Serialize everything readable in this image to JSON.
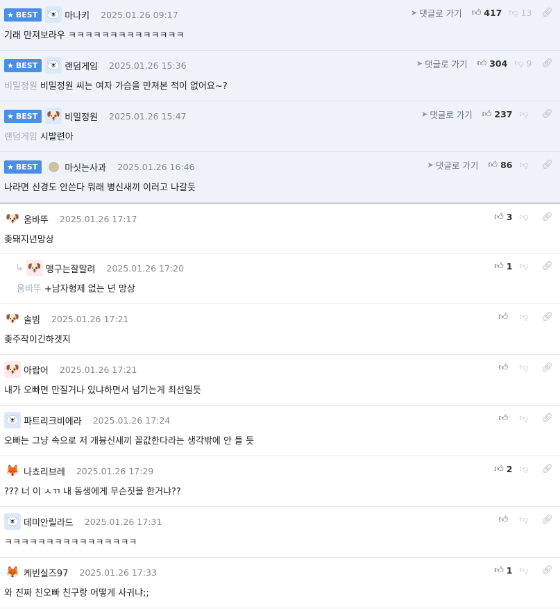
{
  "labels": {
    "best": "BEST",
    "goto": "댓글로 가기"
  },
  "icons": {
    "best": "star-icon",
    "goto": "send-arrow-icon",
    "up": "thumbs-up-icon",
    "down": "thumbs-down-icon",
    "link": "link-icon"
  },
  "colors": {
    "best_bg": "#eef3fa",
    "badge": "#4a8fe7",
    "muted": "#a7adb5"
  },
  "comments": [
    {
      "nick": "마나키",
      "date": "2025.01.26 09:17",
      "text": "기래 만져보라우 ㅋㅋㅋㅋㅋㅋㅋㅋㅋㅋㅋㅋㅋㅋ",
      "mention": "",
      "likes": "417",
      "dislikes": "13"
    },
    {
      "nick": "랜덤게임",
      "date": "2025.01.26 15:36",
      "text": "비밀정원 씨는 여자 가슴을 만져본 적이 없어요~?",
      "mention": "비밀정원",
      "likes": "304",
      "dislikes": "9"
    },
    {
      "nick": "비밀정원",
      "date": "2025.01.26 15:47",
      "text": "시발련아",
      "mention": "랜덤게임",
      "likes": "237",
      "dislikes": ""
    },
    {
      "nick": "마싯는사과",
      "date": "2025.01.26 16:46",
      "text": "나라면 신경도 안쓴다 뭐래 병신새끼 이러고 나갈듯",
      "mention": "",
      "likes": "86",
      "dislikes": ""
    },
    {
      "nick": "움바뚜",
      "date": "2025.01.26 17:17",
      "text": "좆돼지년망상",
      "mention": "",
      "likes": "3",
      "dislikes": ""
    },
    {
      "nick": "맹구는잘말려",
      "date": "2025.01.26 17:20",
      "text": "+남자형제 없는 년 망상",
      "mention": "움바뚜",
      "likes": "1",
      "dislikes": ""
    },
    {
      "nick": "솔빔",
      "date": "2025.01.26 17:21",
      "text": "좆주작이긴하겟지",
      "mention": "",
      "likes": "",
      "dislikes": ""
    },
    {
      "nick": "아랍어",
      "date": "2025.01.26 17:21",
      "text": "내가 오빠면 만질거나 있냐하면서 넘기는게 최선일듯",
      "mention": "",
      "likes": "",
      "dislikes": ""
    },
    {
      "nick": "파트리크비에라",
      "date": "2025.01.26 17:24",
      "text": "오빠는 그냥 속으로 저 개븅신새끼 꼴값한다라는 생각밖에 안 들 듯",
      "mention": "",
      "likes": "",
      "dislikes": ""
    },
    {
      "nick": "나쵸리브레",
      "date": "2025.01.26 17:29",
      "text": "??? 너 이 ㅅㄲ 내 동생에게 무슨짓을 한거냐??",
      "mention": "",
      "likes": "2",
      "dislikes": ""
    },
    {
      "nick": "데미안릴라드",
      "date": "2025.01.26 17:31",
      "text": "ㅋㅋㅋㅋㅋㅋㅋㅋㅋㅋㅋㅋㅋㅋㅋㅋ",
      "mention": "",
      "likes": "",
      "dislikes": ""
    },
    {
      "nick": "케빈실즈97",
      "date": "2025.01.26 17:33",
      "text": "와 진짜 친오빠 친구랑 어떻게 사귀냐;;",
      "mention": "",
      "likes": "1",
      "dislikes": ""
    }
  ]
}
